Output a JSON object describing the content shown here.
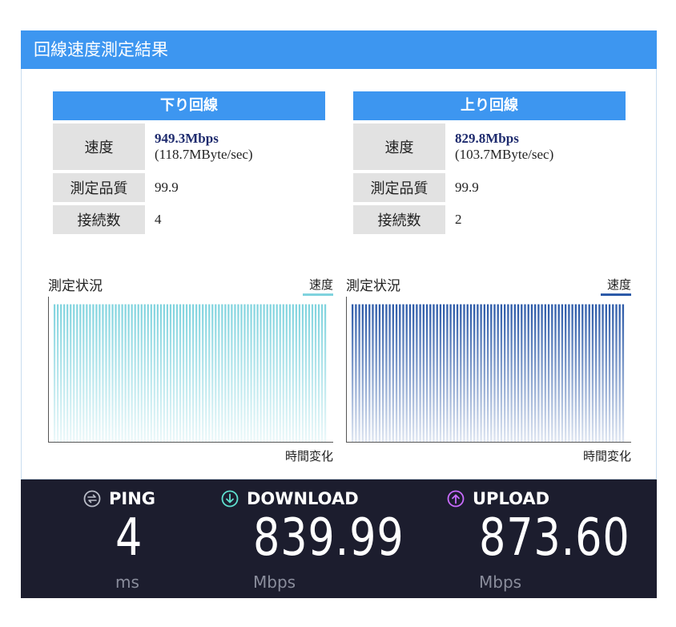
{
  "header": {
    "title": "回線速度測定結果"
  },
  "download": {
    "title": "下り回線",
    "speed_label": "速度",
    "speed_main": "949.3Mbps",
    "speed_sub": "(118.7MByte/sec)",
    "quality_label": "測定品質",
    "quality_value": "99.9",
    "conn_label": "接続数",
    "conn_value": "4"
  },
  "upload": {
    "title": "上り回線",
    "speed_label": "速度",
    "speed_main": "829.8Mbps",
    "speed_sub": "(103.7MByte/sec)",
    "quality_label": "測定品質",
    "quality_value": "99.9",
    "conn_label": "接続数",
    "conn_value": "2"
  },
  "chart_data": [
    {
      "type": "bar",
      "title": "測定状況",
      "legend": "速度",
      "xlabel": "時間変化",
      "color": "#7fd3de",
      "values": [
        0.98,
        0.98,
        0.98,
        0.98,
        0.98,
        0.98,
        0.98,
        0.98,
        0.98,
        0.98,
        0.98,
        0.98,
        0.98,
        0.98,
        0.98,
        0.98,
        0.98,
        0.98,
        0.98,
        0.98,
        0.98,
        0.98,
        0.98,
        0.98,
        0.98,
        0.98,
        0.98,
        0.98,
        0.98,
        0.98,
        0.98,
        0.98,
        0.98,
        0.98,
        0.98,
        0.98,
        0.98,
        0.98,
        0.98,
        0.98,
        0.98,
        0.98,
        0.98,
        0.98,
        0.98,
        0.98,
        0.98,
        0.98,
        0.98,
        0.98,
        0.98,
        0.98,
        0.98,
        0.98,
        0.98,
        0.98,
        0.98,
        0.98,
        0.98,
        0.98,
        0.98,
        0.98,
        0.98,
        0.98,
        0.98,
        0.98,
        0.98,
        0.98,
        0.98,
        0.98,
        0.98,
        0.98,
        0.98,
        0.98,
        0.98,
        0.98,
        0.98,
        0.98,
        0.98,
        0.98,
        0.98,
        0.98,
        0.98,
        0.98,
        0.98
      ],
      "ylim": [
        0,
        1
      ],
      "grid": false,
      "legend_position": "top-right"
    },
    {
      "type": "bar",
      "title": "測定状況",
      "legend": "速度",
      "xlabel": "時間変化",
      "color": "#2c5aa8",
      "values": [
        0.98,
        0.98,
        0.98,
        0.98,
        0.98,
        0.98,
        0.98,
        0.98,
        0.98,
        0.98,
        0.98,
        0.98,
        0.98,
        0.98,
        0.98,
        0.98,
        0.98,
        0.98,
        0.98,
        0.98,
        0.98,
        0.98,
        0.98,
        0.98,
        0.98,
        0.98,
        0.98,
        0.98,
        0.98,
        0.98,
        0.98,
        0.98,
        0.98,
        0.98,
        0.98,
        0.98,
        0.98,
        0.98,
        0.98,
        0.98,
        0.98,
        0.98,
        0.98,
        0.98,
        0.98,
        0.98,
        0.98,
        0.98,
        0.98,
        0.98,
        0.98,
        0.98,
        0.98,
        0.98,
        0.98,
        0.98,
        0.98,
        0.98,
        0.98,
        0.98,
        0.98,
        0.98,
        0.98,
        0.98,
        0.98,
        0.98,
        0.98,
        0.98,
        0.98,
        0.98,
        0.98,
        0.98,
        0.98,
        0.98,
        0.98,
        0.98,
        0.98,
        0.98,
        0.98,
        0.98,
        0.98
      ],
      "ylim": [
        0,
        1
      ],
      "grid": false,
      "legend_position": "top-right"
    }
  ],
  "speedtest": {
    "ping": {
      "label": "PING",
      "value": "4",
      "unit": "ms",
      "icon": "ping-icon",
      "color": "#b9bcc7"
    },
    "download": {
      "label": "DOWNLOAD",
      "value": "839.99",
      "unit": "Mbps",
      "icon": "download-arrow-icon",
      "color": "#5ee0cf"
    },
    "upload": {
      "label": "UPLOAD",
      "value": "873.60",
      "unit": "Mbps",
      "icon": "upload-arrow-icon",
      "color": "#c96bff"
    }
  }
}
